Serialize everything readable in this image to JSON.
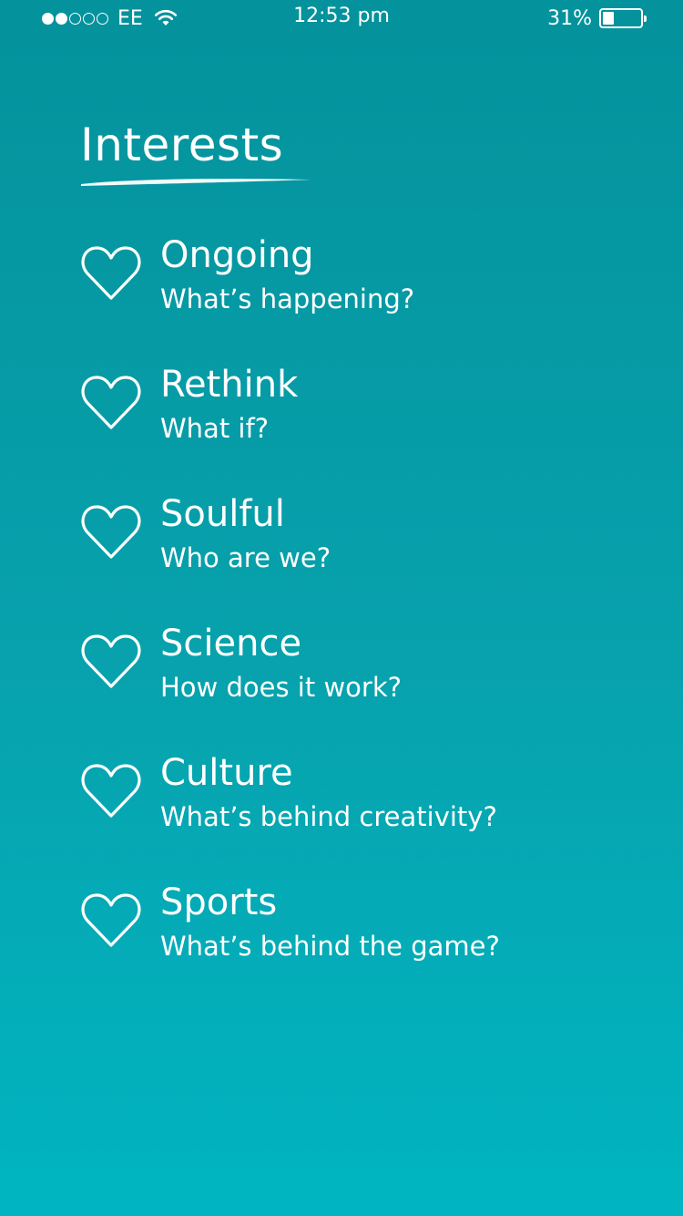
{
  "status_bar": {
    "signal_filled": 2,
    "signal_total": 5,
    "carrier": "EE",
    "time": "12:53 pm",
    "battery_percent": "31%",
    "battery_level": 0.31,
    "icons": [
      "signal-dots-icon",
      "wifi-icon",
      "battery-icon"
    ]
  },
  "page": {
    "title": "Interests"
  },
  "interests": [
    {
      "title": "Ongoing",
      "subtitle": "What’s happening?",
      "icon": "heart-outline-icon"
    },
    {
      "title": "Rethink",
      "subtitle": "What if?",
      "icon": "heart-outline-icon"
    },
    {
      "title": "Soulful",
      "subtitle": "Who are we?",
      "icon": "heart-outline-icon"
    },
    {
      "title": "Science",
      "subtitle": "How does it work?",
      "icon": "heart-outline-icon"
    },
    {
      "title": "Culture",
      "subtitle": "What’s behind creativity?",
      "icon": "heart-outline-icon"
    },
    {
      "title": "Sports",
      "subtitle": "What’s behind the game?",
      "icon": "heart-outline-icon"
    }
  ],
  "colors": {
    "background_top": "#04929c",
    "background_bottom": "#00b5c1",
    "text": "#ffffff"
  }
}
